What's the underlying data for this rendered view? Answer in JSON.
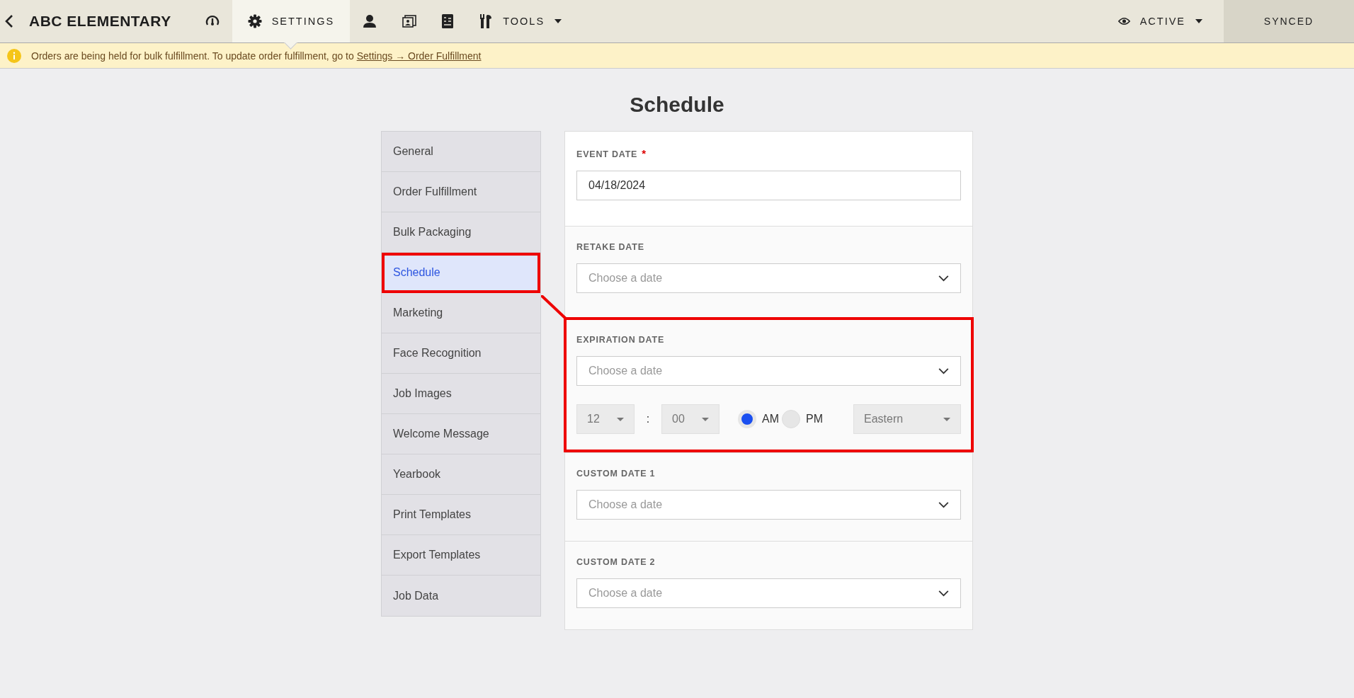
{
  "top_bar": {
    "title": "ABC ELEMENTARY",
    "nav": [
      {
        "selected": false
      },
      {
        "label": "SETTINGS",
        "selected": true
      },
      {
        "selected": false
      },
      {
        "selected": false
      },
      {
        "selected": false
      },
      {
        "label": "TOOLS",
        "selected": false,
        "dropdown": true
      }
    ],
    "status": {
      "label": "ACTIVE"
    },
    "sync": "SYNCED"
  },
  "banner": {
    "text": "Orders are being held for bulk fulfillment. To update order fulfillment, go to ",
    "link": "Settings → Order Fulfillment"
  },
  "page_title": "Schedule",
  "sidebar": {
    "items": [
      {
        "label": "General",
        "selected": false,
        "highlighted": false
      },
      {
        "label": "Order Fulfillment",
        "selected": false,
        "highlighted": false
      },
      {
        "label": "Bulk Packaging",
        "selected": false,
        "highlighted": false
      },
      {
        "label": "Schedule",
        "selected": true,
        "highlighted": true
      },
      {
        "label": "Marketing",
        "selected": false,
        "highlighted": false
      },
      {
        "label": "Face Recognition",
        "selected": false,
        "highlighted": false
      },
      {
        "label": "Job Images",
        "selected": false,
        "highlighted": false
      },
      {
        "label": "Welcome Message",
        "selected": false,
        "highlighted": false
      },
      {
        "label": "Yearbook",
        "selected": false,
        "highlighted": false
      },
      {
        "label": "Print Templates",
        "selected": false,
        "highlighted": false
      },
      {
        "label": "Export Templates",
        "selected": false,
        "highlighted": false
      },
      {
        "label": "Job Data",
        "selected": false,
        "highlighted": false
      }
    ]
  },
  "sections": [
    {
      "kind": "input",
      "label": "EVENT DATE",
      "required_mark": "*",
      "highlighted": false,
      "value": "04/18/2024"
    },
    {
      "kind": "date",
      "label": "RETAKE DATE",
      "highlighted": false,
      "placeholder": "Choose a date"
    },
    {
      "kind": "datetime",
      "label": "EXPIRATION DATE",
      "highlighted": true,
      "placeholder": "Choose a date",
      "hour": "12",
      "separator": ":",
      "minute": "00",
      "periods": [
        {
          "label": "AM",
          "selected": true
        },
        {
          "label": "PM",
          "selected": false
        }
      ],
      "timezone": "Eastern"
    },
    {
      "kind": "date",
      "label": "CUSTOM DATE 1",
      "highlighted": false,
      "placeholder": "Choose a date"
    },
    {
      "kind": "date",
      "label": "CUSTOM DATE 2",
      "highlighted": false,
      "placeholder": "Choose a date"
    }
  ]
}
